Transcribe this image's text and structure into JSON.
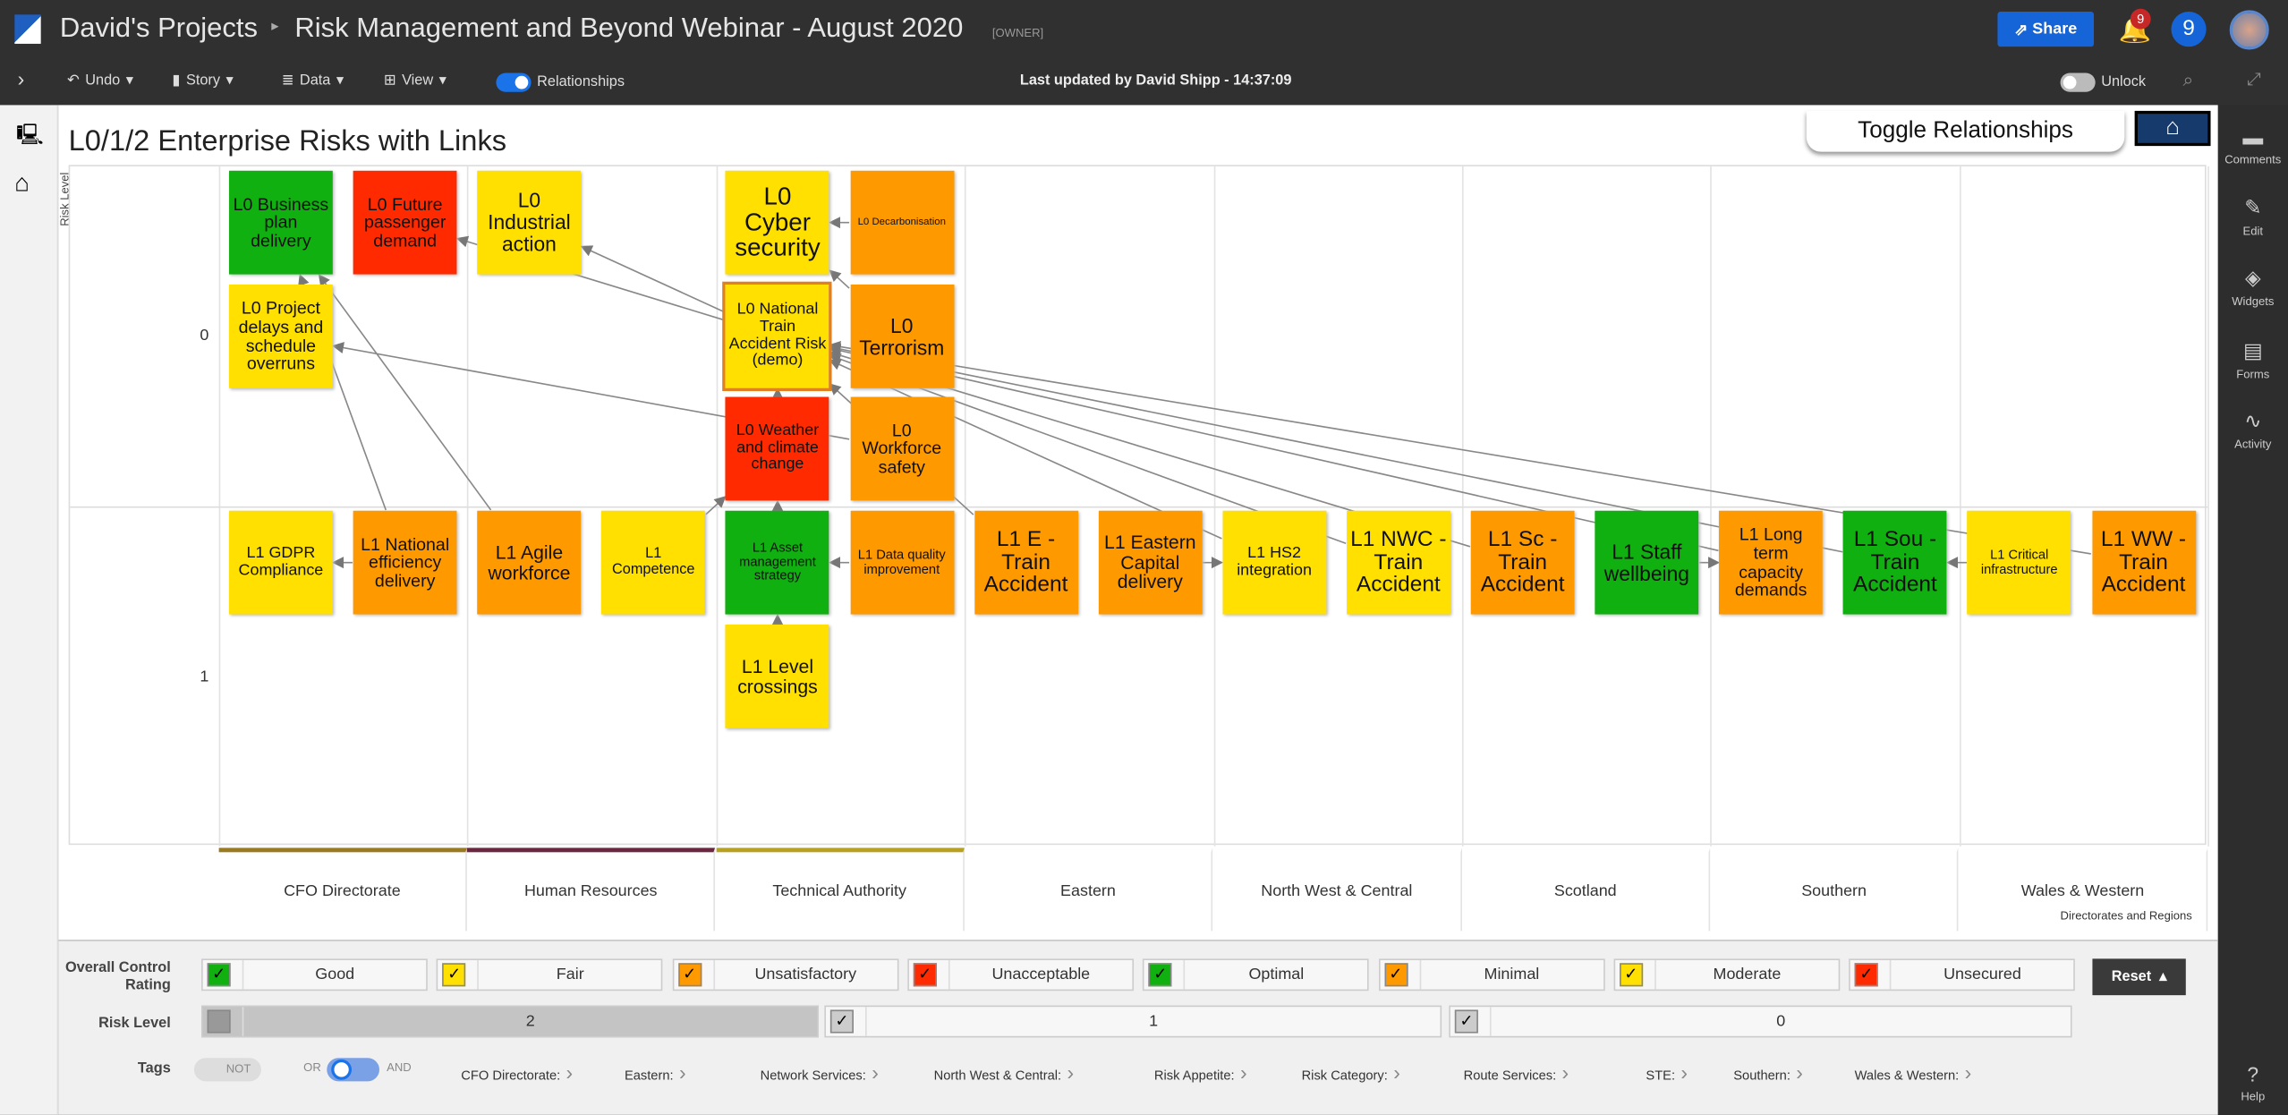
{
  "header": {
    "project": "David's Projects",
    "separator": "▸",
    "title": "Risk Management and Beyond Webinar - August 2020",
    "role": "[OWNER]",
    "share": "Share",
    "notifications": "9",
    "user_initial": "9"
  },
  "toolbar": {
    "undo": "Undo",
    "story": "Story",
    "data": "Data",
    "view": "View",
    "relationships": "Relationships",
    "relationships_on": true,
    "last_updated": "Last updated by David Shipp - 14:37:09",
    "unlock": "Unlock",
    "unlock_on": false
  },
  "right_sidebar": [
    {
      "label": "Comments",
      "icon": "comment-icon"
    },
    {
      "label": "Edit",
      "icon": "pencil-icon"
    },
    {
      "label": "Widgets",
      "icon": "layers-icon"
    },
    {
      "label": "Forms",
      "icon": "clipboard-icon"
    },
    {
      "label": "Activity",
      "icon": "pulse-icon"
    },
    {
      "label": "Help",
      "icon": "help-icon"
    }
  ],
  "canvas": {
    "title": "L0/1/2 Enterprise Risks with Links",
    "toggle_button": "Toggle Relationships",
    "home_icon": "home-icon",
    "y_axis_label": "Risk Level",
    "y_ticks": [
      "0",
      "1"
    ],
    "footer_label": "Directorates and Regions"
  },
  "colors": {
    "green": "#10b010",
    "yellow": "#ffe000",
    "orange": "#ff9900",
    "red": "#ff2a00"
  },
  "directorates": [
    {
      "name": "CFO Directorate",
      "color": "#9a7a20"
    },
    {
      "name": "Human Resources",
      "color": "#6b2740"
    },
    {
      "name": "Technical Authority",
      "color": "#b8a020"
    },
    {
      "name": "Eastern",
      "color": ""
    },
    {
      "name": "North West & Central",
      "color": ""
    },
    {
      "name": "Scotland",
      "color": ""
    },
    {
      "name": "Southern",
      "color": ""
    },
    {
      "name": "Wales & Western",
      "color": ""
    }
  ],
  "cards": [
    {
      "id": "bpd",
      "label": "L0 Business plan delivery",
      "rating": "green",
      "level": "0"
    },
    {
      "id": "fpd",
      "label": "L0 Future passenger demand",
      "rating": "red",
      "level": "0"
    },
    {
      "id": "ia",
      "label": "L0 Industrial action",
      "rating": "yellow",
      "level": "0"
    },
    {
      "id": "cyber",
      "label": "L0 Cyber security",
      "rating": "yellow",
      "level": "0"
    },
    {
      "id": "decarb",
      "label": "L0 Decarbonisation",
      "rating": "orange",
      "level": "0"
    },
    {
      "id": "pdso",
      "label": "L0 Project delays and schedule overruns",
      "rating": "yellow",
      "level": "0"
    },
    {
      "id": "ntar",
      "label": "L0 National Train Accident Risk (demo)",
      "rating": "yellow",
      "level": "0"
    },
    {
      "id": "terror",
      "label": "L0 Terrorism",
      "rating": "orange",
      "level": "0"
    },
    {
      "id": "weather",
      "label": "L0 Weather and climate change",
      "rating": "red",
      "level": "0"
    },
    {
      "id": "wfs",
      "label": "L0 Workforce safety",
      "rating": "orange",
      "level": "0"
    },
    {
      "id": "gdpr",
      "label": "L1 GDPR Compliance",
      "rating": "yellow",
      "level": "1"
    },
    {
      "id": "ned",
      "label": "L1 National efficiency delivery",
      "rating": "orange",
      "level": "1"
    },
    {
      "id": "agile",
      "label": "L1 Agile workforce",
      "rating": "orange",
      "level": "1"
    },
    {
      "id": "comp",
      "label": "L1 Competence",
      "rating": "yellow",
      "level": "1"
    },
    {
      "id": "asset",
      "label": "L1 Asset management strategy",
      "rating": "green",
      "level": "1"
    },
    {
      "id": "dq",
      "label": "L1 Data quality improvement",
      "rating": "orange",
      "level": "1"
    },
    {
      "id": "eta",
      "label": "L1 E - Train Accident",
      "rating": "orange",
      "level": "1"
    },
    {
      "id": "ecd",
      "label": "L1 Eastern Capital delivery",
      "rating": "orange",
      "level": "1"
    },
    {
      "id": "hs2",
      "label": "L1 HS2 integration",
      "rating": "yellow",
      "level": "1"
    },
    {
      "id": "nwc",
      "label": "L1 NWC - Train Accident",
      "rating": "yellow",
      "level": "1"
    },
    {
      "id": "sc",
      "label": "L1 Sc - Train Accident",
      "rating": "orange",
      "level": "1"
    },
    {
      "id": "staff",
      "label": "L1 Staff wellbeing",
      "rating": "green",
      "level": "1"
    },
    {
      "id": "ltcd",
      "label": "L1 Long term capacity demands",
      "rating": "orange",
      "level": "1"
    },
    {
      "id": "sou",
      "label": "L1 Sou - Train Accident",
      "rating": "green",
      "level": "1"
    },
    {
      "id": "ci",
      "label": "L1 Critical infrastructure",
      "rating": "yellow",
      "level": "1"
    },
    {
      "id": "ww",
      "label": "L1 WW - Train Accident",
      "rating": "orange",
      "level": "1"
    },
    {
      "id": "lc",
      "label": "L1 Level crossings",
      "rating": "yellow",
      "level": "1"
    }
  ],
  "relationships": [
    [
      "ned",
      "gdpr"
    ],
    [
      "ned",
      "bpd"
    ],
    [
      "agile",
      "bpd"
    ],
    [
      "comp",
      "weather"
    ],
    [
      "dq",
      "asset"
    ],
    [
      "asset",
      "weather"
    ],
    [
      "lc",
      "asset"
    ],
    [
      "eta",
      "ntar"
    ],
    [
      "nwc",
      "ntar"
    ],
    [
      "sc",
      "ntar"
    ],
    [
      "sou",
      "ntar"
    ],
    [
      "ww",
      "ntar"
    ],
    [
      "ecd",
      "hs2"
    ],
    [
      "staff",
      "ltcd"
    ],
    [
      "ci",
      "sou"
    ],
    [
      "wfs",
      "pdso"
    ],
    [
      "ntar",
      "ia"
    ],
    [
      "ntar",
      "fpd"
    ],
    [
      "decarb",
      "cyber"
    ],
    [
      "terror",
      "cyber"
    ],
    [
      "ltcd",
      "ntar"
    ],
    [
      "hs2",
      "ntar"
    ],
    [
      "weather",
      "ntar"
    ]
  ],
  "filters": {
    "rating_label": "Overall Control Rating",
    "ratings": [
      {
        "label": "Good",
        "color": "#10b010",
        "checked": true
      },
      {
        "label": "Fair",
        "color": "#ffe000",
        "checked": true
      },
      {
        "label": "Unsatisfactory",
        "color": "#ff9900",
        "checked": true
      },
      {
        "label": "Unacceptable",
        "color": "#ff2a00",
        "checked": true
      },
      {
        "label": "Optimal",
        "color": "#10b010",
        "checked": true
      },
      {
        "label": "Minimal",
        "color": "#ff9900",
        "checked": true
      },
      {
        "label": "Moderate",
        "color": "#ffe000",
        "checked": true
      },
      {
        "label": "Unsecured",
        "color": "#ff2a00",
        "checked": true
      }
    ],
    "risk_level_label": "Risk Level",
    "risk_levels": [
      {
        "label": "2",
        "checked": false
      },
      {
        "label": "1",
        "checked": true
      },
      {
        "label": "0",
        "checked": true
      }
    ],
    "tags_label": "Tags",
    "not": "NOT",
    "or": "OR",
    "and": "AND",
    "tags": [
      "CFO Directorate:",
      "Eastern:",
      "Network Services:",
      "North West & Central:",
      "Risk Appetite:",
      "Risk Category:",
      "Route Services:",
      "STE:",
      "Southern:",
      "Wales & Western:"
    ],
    "reset": "Reset"
  }
}
